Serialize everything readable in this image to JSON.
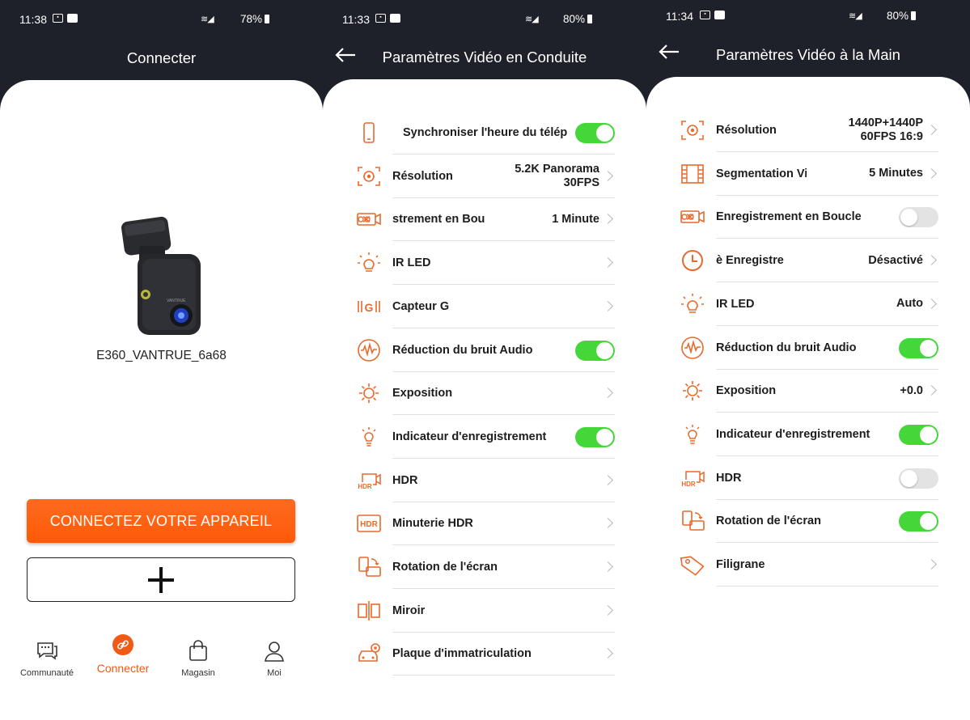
{
  "colors": {
    "accent": "#f05a14",
    "toggle_on": "#45d639",
    "toggle_off": "#e3e3e3",
    "header_bg": "#1e2129"
  },
  "screen1": {
    "status": {
      "time": "11:38",
      "battery": "78%"
    },
    "title": "Connecter",
    "device_name": "E360_VANTRUE_6a68",
    "device_brand": "VANTRUE",
    "connect_button": "CONNECTEZ VOTRE APPAREIL",
    "nav": [
      {
        "label": "Communauté",
        "icon": "chat-icon"
      },
      {
        "label": "Connecter",
        "icon": "link-icon"
      },
      {
        "label": "Magasin",
        "icon": "bag-icon"
      },
      {
        "label": "Moi",
        "icon": "person-icon"
      }
    ]
  },
  "screen2": {
    "status": {
      "time": "11:33",
      "battery": "80%"
    },
    "title": "Paramètres Vidéo en Conduite",
    "rows": [
      {
        "icon": "phone-icon",
        "label": "Synchroniser l'heure du téléph",
        "control": "toggle",
        "on": true
      },
      {
        "icon": "resolution-icon",
        "label": "Résolution",
        "value": "5.2K Panorama 30FPS",
        "value_lines": [
          "5.2K Panorama",
          "30FPS"
        ],
        "control": "chevron"
      },
      {
        "icon": "loop-record-icon",
        "label": "strement en Bou",
        "value": "1 Minute",
        "control": "chevron"
      },
      {
        "icon": "ir-led-icon",
        "label": "IR LED",
        "value": "",
        "control": "chevron"
      },
      {
        "icon": "g-sensor-icon",
        "label": "Capteur G",
        "value": "",
        "control": "chevron"
      },
      {
        "icon": "audio-noise-icon",
        "label": "Réduction du bruit Audio",
        "control": "toggle",
        "on": true
      },
      {
        "icon": "exposure-icon",
        "label": "Exposition",
        "value": "",
        "control": "chevron"
      },
      {
        "icon": "record-indicator-icon",
        "label": "Indicateur d'enregistrement",
        "control": "toggle",
        "on": true
      },
      {
        "icon": "hdr-icon",
        "label": "HDR",
        "value": "",
        "control": "chevron"
      },
      {
        "icon": "hdr-timer-icon",
        "label": "Minuterie HDR",
        "value": "",
        "control": "chevron"
      },
      {
        "icon": "screen-rotation-icon",
        "label": "Rotation de l'écran",
        "value": "",
        "control": "chevron"
      },
      {
        "icon": "mirror-icon",
        "label": "Miroir",
        "value": "",
        "control": "chevron"
      },
      {
        "icon": "license-plate-icon",
        "label": "Plaque d'immatriculation",
        "value": "",
        "control": "chevron"
      }
    ]
  },
  "screen3": {
    "status": {
      "time": "11:34",
      "battery": "80%"
    },
    "title": "Paramètres Vidéo à la Main",
    "rows": [
      {
        "icon": "resolution-icon",
        "label": "Résolution",
        "value": "1440P+1440P 60FPS 16:9",
        "value_lines": [
          "1440P+1440P",
          "60FPS 16:9"
        ],
        "control": "chevron"
      },
      {
        "icon": "segmentation-icon",
        "label": "Segmentation Vi",
        "value": "5 Minutes",
        "control": "chevron"
      },
      {
        "icon": "loop-record-icon",
        "label": "Enregistrement en Boucle",
        "control": "toggle",
        "on": false
      },
      {
        "icon": "timer-record-icon",
        "label": "è        Enregistre",
        "value": "Désactivé",
        "control": "chevron"
      },
      {
        "icon": "ir-led-icon",
        "label": "IR LED",
        "value": "Auto",
        "control": "chevron"
      },
      {
        "icon": "audio-noise-icon",
        "label": "Réduction du bruit Audio",
        "control": "toggle",
        "on": true
      },
      {
        "icon": "exposure-icon",
        "label": "Exposition",
        "value": "+0.0",
        "control": "chevron"
      },
      {
        "icon": "record-indicator-icon",
        "label": "Indicateur d'enregistrement",
        "control": "toggle",
        "on": true
      },
      {
        "icon": "hdr-icon",
        "label": "HDR",
        "control": "toggle",
        "on": false
      },
      {
        "icon": "screen-rotation-icon",
        "label": "Rotation de l'écran",
        "control": "toggle",
        "on": true
      },
      {
        "icon": "watermark-icon",
        "label": "Filigrane",
        "value": "",
        "control": "chevron"
      }
    ]
  }
}
